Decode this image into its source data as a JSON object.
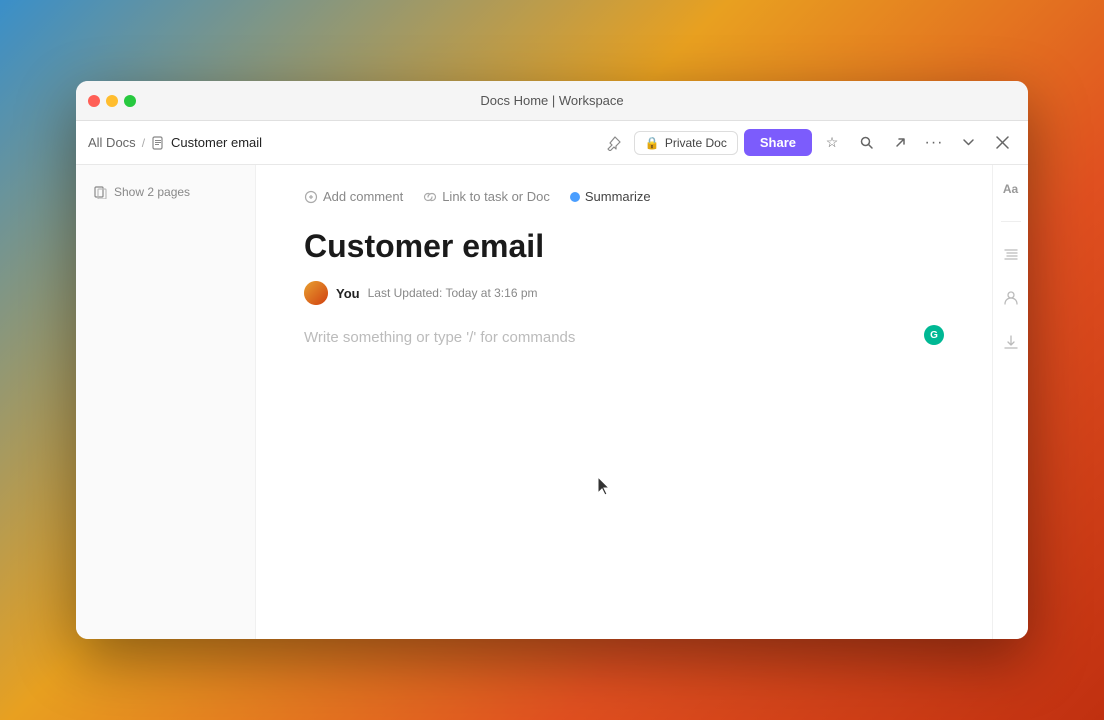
{
  "window": {
    "title": "Docs Home | Workspace"
  },
  "titlebar": {
    "traffic": {
      "close": "close",
      "minimize": "minimize",
      "maximize": "maximize"
    }
  },
  "navbar": {
    "breadcrumb": {
      "all_docs": "All Docs",
      "separator": "/",
      "current": "Customer email"
    },
    "actions": {
      "private_doc": "Private Doc",
      "share": "Share",
      "lock_icon": "🔒",
      "star_icon": "☆",
      "search_icon": "⌕",
      "export_icon": "↗",
      "more_icon": "···",
      "minimize_icon": "⤢",
      "close_icon": "✕",
      "pin_icon": "📌"
    }
  },
  "sidebar": {
    "show_pages_label": "Show 2 pages",
    "pages_icon": "pages-icon"
  },
  "doc_toolbar": {
    "add_comment": "Add comment",
    "link_task": "Link to task or Doc",
    "summarize": "Summarize",
    "comment_icon": "comment-icon",
    "link_icon": "link-icon",
    "summarize_icon": "summarize-icon"
  },
  "document": {
    "title": "Customer email",
    "author": "You",
    "last_updated_prefix": "Last Updated:",
    "last_updated_time": "Today at 3:16 pm",
    "editor_placeholder": "Write something or type '/' for commands",
    "green_dot_initial": "G"
  },
  "right_panel": {
    "text_format_icon": "Aa",
    "star_icon": "☆",
    "people_icon": "👤",
    "download_icon": "⬇",
    "menu_icon": "≡"
  }
}
